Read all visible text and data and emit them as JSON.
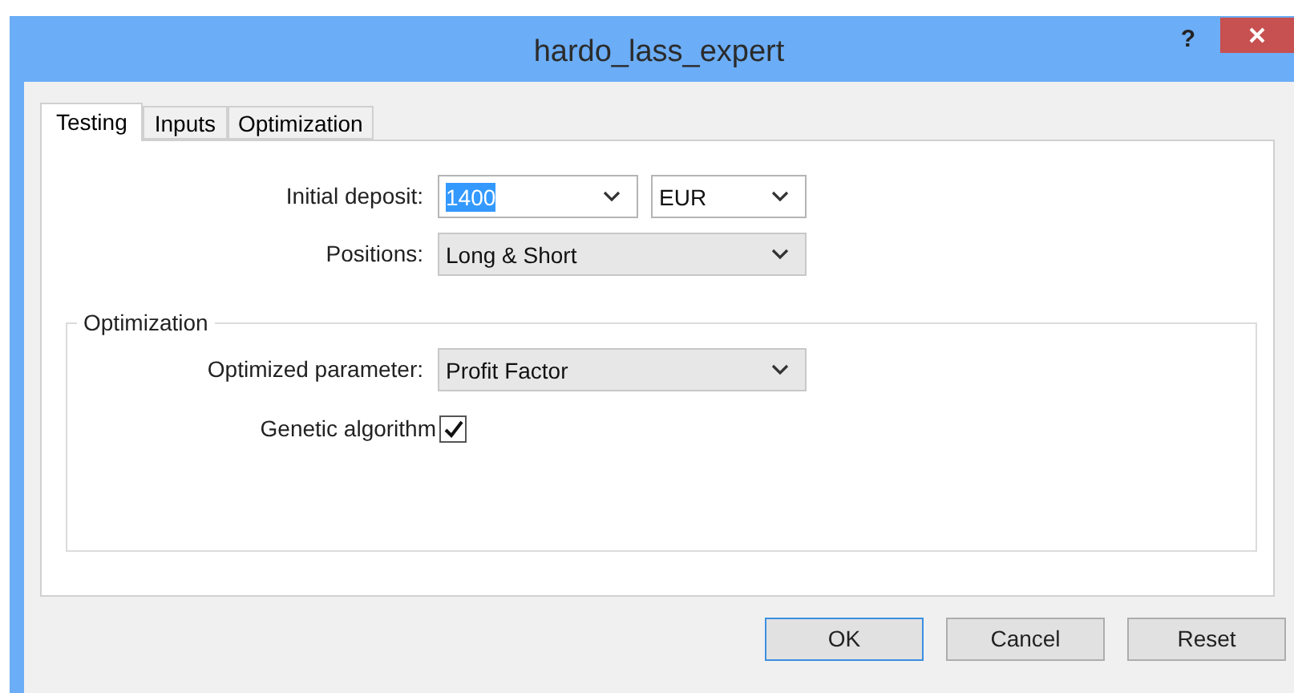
{
  "window": {
    "title": "hardo_lass_expert",
    "help": "?"
  },
  "tabs": [
    {
      "label": "Testing",
      "selected": true
    },
    {
      "label": "Inputs",
      "selected": false
    },
    {
      "label": "Optimization",
      "selected": false
    }
  ],
  "deposit": {
    "label": "Initial deposit:",
    "value": "1400",
    "currency": "EUR"
  },
  "positions": {
    "label": "Positions:",
    "value": "Long & Short"
  },
  "optimization": {
    "title": "Optimization",
    "parameter_label": "Optimized parameter:",
    "parameter": "Profit Factor",
    "genetic_label": "Genetic algorithm",
    "genetic_checked": true
  },
  "buttons": [
    {
      "label": "OK",
      "default": true
    },
    {
      "label": "Cancel",
      "default": false
    },
    {
      "label": "Reset",
      "default": false
    }
  ]
}
